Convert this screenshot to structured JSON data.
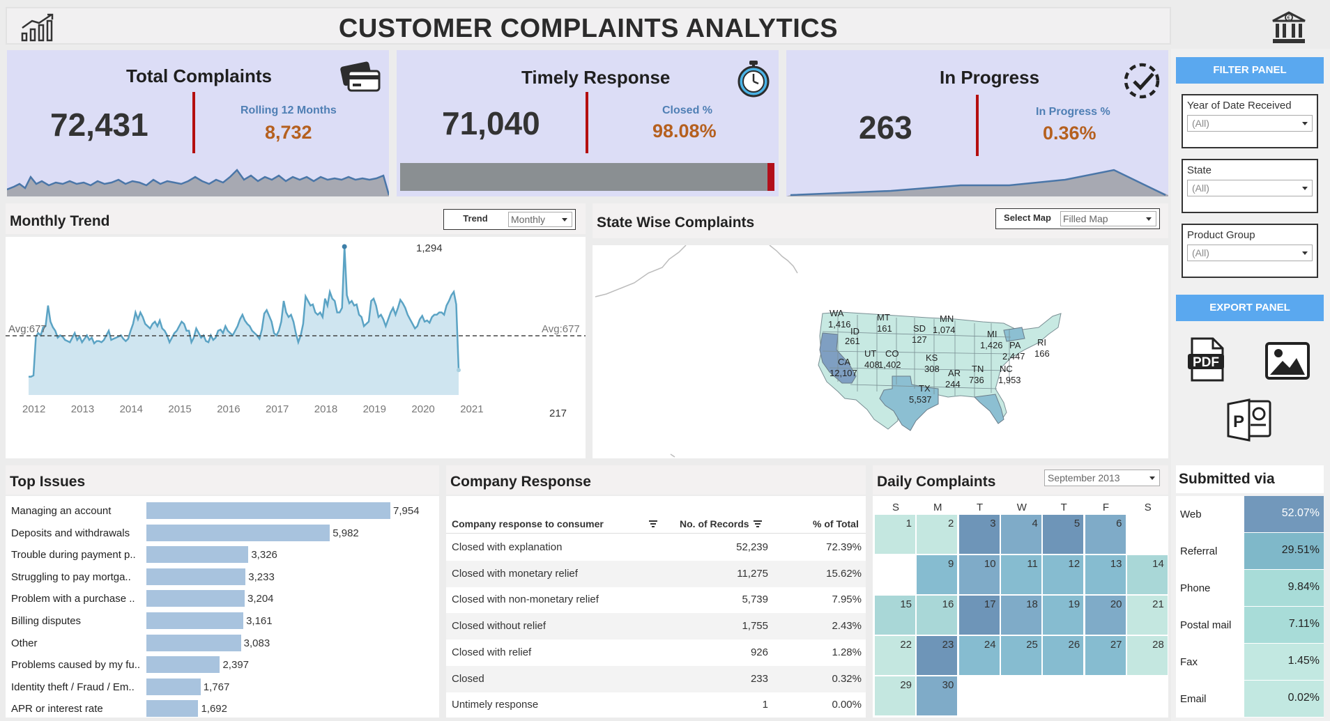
{
  "header": {
    "title": "CUSTOMER COMPLAINTS ANALYTICS",
    "left_icon": "growth-chart-icon",
    "right_icon": "bank-euro-icon"
  },
  "kpis": {
    "total": {
      "title": "Total Complaints",
      "value": "72,431",
      "sub_label": "Rolling 12 Months",
      "sub_value": "8,732",
      "icon": "credit-card-icon"
    },
    "timely": {
      "title": "Timely Response",
      "value": "71,040",
      "sub_label": "Closed %",
      "sub_value": "98.08%",
      "icon": "stopwatch-icon",
      "closed_fraction": 0.9808
    },
    "progress": {
      "title": "In Progress",
      "value": "263",
      "sub_label": "In Progress %",
      "sub_value": "0.36%",
      "icon": "circle-check-icon"
    }
  },
  "filter_panel": {
    "title": "FILTER PANEL",
    "filters": [
      {
        "label": "Year of Date Received",
        "value": "(All)"
      },
      {
        "label": "State",
        "value": "(All)"
      },
      {
        "label": "Product Group",
        "value": "(All)"
      }
    ]
  },
  "export_panel": {
    "title": "EXPORT PANEL",
    "icons": [
      "pdf-icon",
      "image-icon",
      "powerpoint-icon"
    ]
  },
  "monthly_trend": {
    "title": "Monthly Trend",
    "control_label": "Trend",
    "control_value": "Monthly",
    "avg_label_left": "Avg:677",
    "avg_label_right": "Avg:677",
    "peak_label": "1,294",
    "last_label": "217",
    "years": [
      "2012",
      "2013",
      "2014",
      "2015",
      "2016",
      "2017",
      "2018",
      "2019",
      "2020",
      "2021"
    ]
  },
  "state_map": {
    "title": "State Wise Complaints",
    "control_label": "Select Map",
    "control_value": "Filled Map",
    "labels": [
      {
        "state": "WA",
        "value": "1,416"
      },
      {
        "state": "MT",
        "value": "161"
      },
      {
        "state": "MN",
        "value": "1,074"
      },
      {
        "state": "ID",
        "value": "261"
      },
      {
        "state": "SD",
        "value": "127"
      },
      {
        "state": "MI",
        "value": "1,426"
      },
      {
        "state": "PA",
        "value": "2,447"
      },
      {
        "state": "RI",
        "value": "166"
      },
      {
        "state": "CA",
        "value": "12,107"
      },
      {
        "state": "UT",
        "value": "408"
      },
      {
        "state": "CO",
        "value": "1,402"
      },
      {
        "state": "KS",
        "value": "308"
      },
      {
        "state": "TN",
        "value": "736"
      },
      {
        "state": "NC",
        "value": "1,953"
      },
      {
        "state": "AR",
        "value": "244"
      },
      {
        "state": "TX",
        "value": "5,537"
      }
    ]
  },
  "top_issues": {
    "title": "Top Issues",
    "max": 7954,
    "items": [
      {
        "label": "Managing an account",
        "value": 7954,
        "display": "7,954"
      },
      {
        "label": "Deposits and withdrawals",
        "value": 5982,
        "display": "5,982"
      },
      {
        "label": "Trouble during payment p..",
        "value": 3326,
        "display": "3,326"
      },
      {
        "label": "Struggling to pay mortga..",
        "value": 3233,
        "display": "3,233"
      },
      {
        "label": "Problem with a purchase ..",
        "value": 3204,
        "display": "3,204"
      },
      {
        "label": "Billing disputes",
        "value": 3161,
        "display": "3,161"
      },
      {
        "label": "Other",
        "value": 3083,
        "display": "3,083"
      },
      {
        "label": "Problems caused by my fu..",
        "value": 2397,
        "display": "2,397"
      },
      {
        "label": "Identity theft / Fraud / Em..",
        "value": 1767,
        "display": "1,767"
      },
      {
        "label": "APR or interest rate",
        "value": 1692,
        "display": "1,692"
      }
    ]
  },
  "company_response": {
    "title": "Company Response",
    "headers": [
      "Company response to consumer",
      "No. of Records",
      "% of Total"
    ],
    "rows": [
      [
        "Closed with explanation",
        "52,239",
        "72.39%"
      ],
      [
        "Closed with monetary relief",
        "11,275",
        "15.62%"
      ],
      [
        "Closed with non-monetary relief",
        "5,739",
        "7.95%"
      ],
      [
        "Closed without relief",
        "1,755",
        "2.43%"
      ],
      [
        "Closed with relief",
        "926",
        "1.28%"
      ],
      [
        "Closed",
        "233",
        "0.32%"
      ],
      [
        "Untimely response",
        "1",
        "0.00%"
      ]
    ]
  },
  "daily": {
    "title": "Daily Complaints",
    "month": "September 2013",
    "weekdays": [
      "S",
      "M",
      "T",
      "W",
      "T",
      "F",
      "S"
    ],
    "days": [
      {
        "d": "1",
        "c": "#c4e7e0"
      },
      {
        "d": "2",
        "c": "#c4e7e0"
      },
      {
        "d": "3",
        "c": "#6e95b8"
      },
      {
        "d": "4",
        "c": "#7fabc8"
      },
      {
        "d": "5",
        "c": "#6e95b8"
      },
      {
        "d": "6",
        "c": "#7fabc8"
      },
      {
        "d": "9",
        "c": "#86bcd0"
      },
      {
        "d": "10",
        "c": "#7fabc8"
      },
      {
        "d": "11",
        "c": "#86bcd0"
      },
      {
        "d": "12",
        "c": "#86bcd0"
      },
      {
        "d": "13",
        "c": "#86bcd0"
      },
      {
        "d": "14",
        "c": "#a9d7d7"
      },
      {
        "d": "15",
        "c": "#a9d7d7"
      },
      {
        "d": "16",
        "c": "#a9d7d7"
      },
      {
        "d": "17",
        "c": "#6e95b8"
      },
      {
        "d": "18",
        "c": "#7fabc8"
      },
      {
        "d": "19",
        "c": "#86bcd0"
      },
      {
        "d": "20",
        "c": "#7fabc8"
      },
      {
        "d": "21",
        "c": "#c4e7e0"
      },
      {
        "d": "22",
        "c": "#c4e7e0"
      },
      {
        "d": "23",
        "c": "#6e95b8"
      },
      {
        "d": "24",
        "c": "#86bcd0"
      },
      {
        "d": "25",
        "c": "#86bcd0"
      },
      {
        "d": "26",
        "c": "#86bcd0"
      },
      {
        "d": "27",
        "c": "#86bcd0"
      },
      {
        "d": "28",
        "c": "#c4e7e0"
      },
      {
        "d": "29",
        "c": "#c4e7e0"
      },
      {
        "d": "30",
        "c": "#7fabc8"
      }
    ]
  },
  "submitted_via": {
    "title": "Submitted via",
    "rows": [
      {
        "label": "Web",
        "value": "52.07%",
        "color": "#7298bb",
        "light": true
      },
      {
        "label": "Referral",
        "value": "29.51%",
        "color": "#7fb8c9",
        "light": false
      },
      {
        "label": "Phone",
        "value": "9.84%",
        "color": "#a8dcd8",
        "light": false
      },
      {
        "label": "Postal mail",
        "value": "7.11%",
        "color": "#a8dcd8",
        "light": false
      },
      {
        "label": "Fax",
        "value": "1.45%",
        "color": "#c2e8e1",
        "light": false
      },
      {
        "label": "Email",
        "value": "0.02%",
        "color": "#c2e8e1",
        "light": false
      }
    ]
  },
  "chart_data": {
    "type": "area",
    "title": "Monthly Trend",
    "x_labels": [
      "2012",
      "2013",
      "2014",
      "2015",
      "2016",
      "2017",
      "2018",
      "2019",
      "2020",
      "2021"
    ],
    "values": [
      160,
      160,
      170,
      510,
      540,
      520,
      590,
      600,
      780,
      640,
      590,
      560,
      500,
      520,
      510,
      480,
      470,
      460,
      500,
      540,
      480,
      510,
      460,
      490,
      520,
      480,
      500,
      450,
      470,
      470,
      460,
      480,
      520,
      560,
      480,
      490,
      500,
      510,
      520,
      490,
      470,
      490,
      560,
      620,
      720,
      660,
      720,
      680,
      620,
      600,
      580,
      620,
      640,
      600,
      650,
      580,
      560,
      520,
      460,
      500,
      540,
      560,
      600,
      640,
      620,
      560,
      560,
      460,
      500,
      580,
      540,
      500,
      520,
      470,
      460,
      520,
      480,
      500,
      560,
      570,
      540,
      600,
      560,
      540,
      520,
      560,
      600,
      660,
      700,
      650,
      620,
      600,
      560,
      540,
      520,
      490,
      570,
      710,
      740,
      690,
      640,
      540,
      520,
      560,
      640,
      820,
      720,
      680,
      700,
      640,
      540,
      460,
      520,
      620,
      860,
      820,
      780,
      790,
      720,
      700,
      720,
      680,
      840,
      780,
      900,
      840,
      820,
      720,
      720,
      760,
      1294,
      870,
      800,
      820,
      780,
      790,
      700,
      680,
      600,
      620,
      640,
      820,
      840,
      780,
      680,
      700,
      660,
      600,
      660,
      720,
      760,
      700,
      760,
      830,
      800,
      760,
      700,
      660,
      620,
      580,
      600,
      660,
      690,
      640,
      650,
      630,
      680,
      700,
      700,
      720,
      720,
      700,
      780,
      820,
      870,
      900,
      790,
      217
    ],
    "ylim": [
      0,
      1400
    ],
    "average": 677
  }
}
